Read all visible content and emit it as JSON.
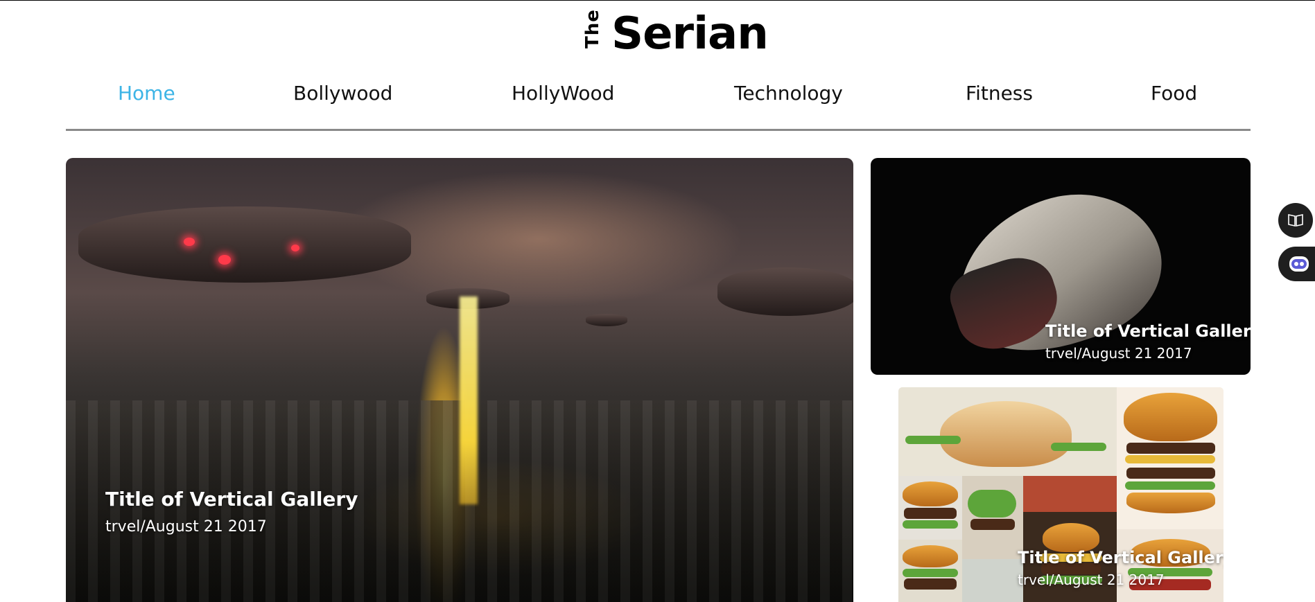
{
  "logo": {
    "prefix": "The",
    "name": "Serian"
  },
  "nav": {
    "items": [
      {
        "label": "Home",
        "active": true
      },
      {
        "label": "Bollywood",
        "active": false
      },
      {
        "label": "HollyWood",
        "active": false
      },
      {
        "label": "Technology",
        "active": false
      },
      {
        "label": "Fitness",
        "active": false
      },
      {
        "label": "Food",
        "active": false
      }
    ]
  },
  "hero": {
    "title": "Title of Vertical Gallery",
    "meta": "trvel/August 21 2017"
  },
  "side_top": {
    "title": "Title of Vertical Gallery",
    "meta": "trvel/August 21 2017"
  },
  "side_bottom": {
    "title": "Title of Vertical Gallery",
    "meta": "trvel/August 21 2017"
  },
  "widgets": {
    "book_icon": "book-icon",
    "bot_icon": "bot-icon"
  },
  "colors": {
    "active_nav": "#3cb4e6",
    "nav_rule": "#8a8a8a"
  }
}
